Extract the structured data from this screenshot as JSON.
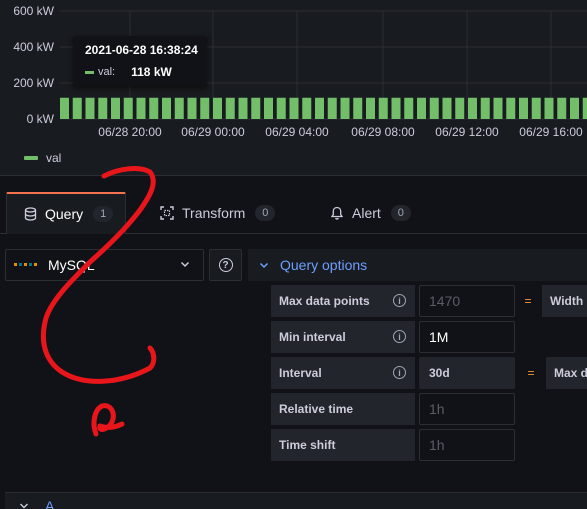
{
  "chart": {
    "tooltip": {
      "time": "2021-06-28 16:38:24",
      "series_label": "val:",
      "series_value": "118 kW"
    },
    "legend": {
      "label": "val"
    },
    "colors": {
      "series": "#73bf69",
      "grid": "#2c2e33",
      "axis_text": "#ccccdc"
    }
  },
  "chart_data": {
    "type": "bar",
    "y_ticks": [
      "0 kW",
      "200 kW",
      "400 kW",
      "600 kW"
    ],
    "x_ticks": [
      "06/28 20:00",
      "06/29 00:00",
      "06/29 04:00",
      "06/29 08:00",
      "06/29 12:00",
      "06/29 16:00"
    ],
    "ylim": [
      0,
      600
    ],
    "unit": "kW",
    "series": [
      {
        "name": "val",
        "values": [
          118,
          118,
          118,
          118,
          118,
          118,
          118,
          118,
          118,
          118,
          118,
          118,
          118,
          118,
          118,
          118,
          118,
          118,
          118,
          118,
          118,
          118,
          118,
          118,
          118,
          118,
          118,
          118,
          118,
          118,
          118,
          118,
          118,
          118,
          118,
          118,
          118,
          118,
          118,
          118,
          118,
          118,
          118
        ]
      }
    ]
  },
  "tabs": [
    {
      "label": "Query",
      "count": "1",
      "icon": "database-icon",
      "active": true
    },
    {
      "label": "Transform",
      "count": "0",
      "icon": "transform-icon",
      "active": false
    },
    {
      "label": "Alert",
      "count": "0",
      "icon": "bell-icon",
      "active": false
    }
  ],
  "datasource": {
    "name": "MySQL"
  },
  "query_options": {
    "header": "Query options",
    "rows": [
      {
        "label": "Max data points",
        "value": "1470",
        "is_placeholder": true,
        "extra": "Width o"
      },
      {
        "label": "Min interval",
        "value": "1M",
        "is_placeholder": false
      },
      {
        "label": "Interval",
        "value": "30d",
        "is_placeholder": false,
        "plain": true,
        "extra": "Max d"
      },
      {
        "label": "Relative time",
        "value": "1h",
        "is_placeholder": true
      },
      {
        "label": "Time shift",
        "value": "1h",
        "is_placeholder": true
      }
    ],
    "equals": "="
  },
  "query_row": {
    "letter": "A"
  },
  "colors": {
    "accent_blue": "#6e9fff",
    "active_tab": "#f5744f",
    "annotation_red": "#e8161a"
  }
}
